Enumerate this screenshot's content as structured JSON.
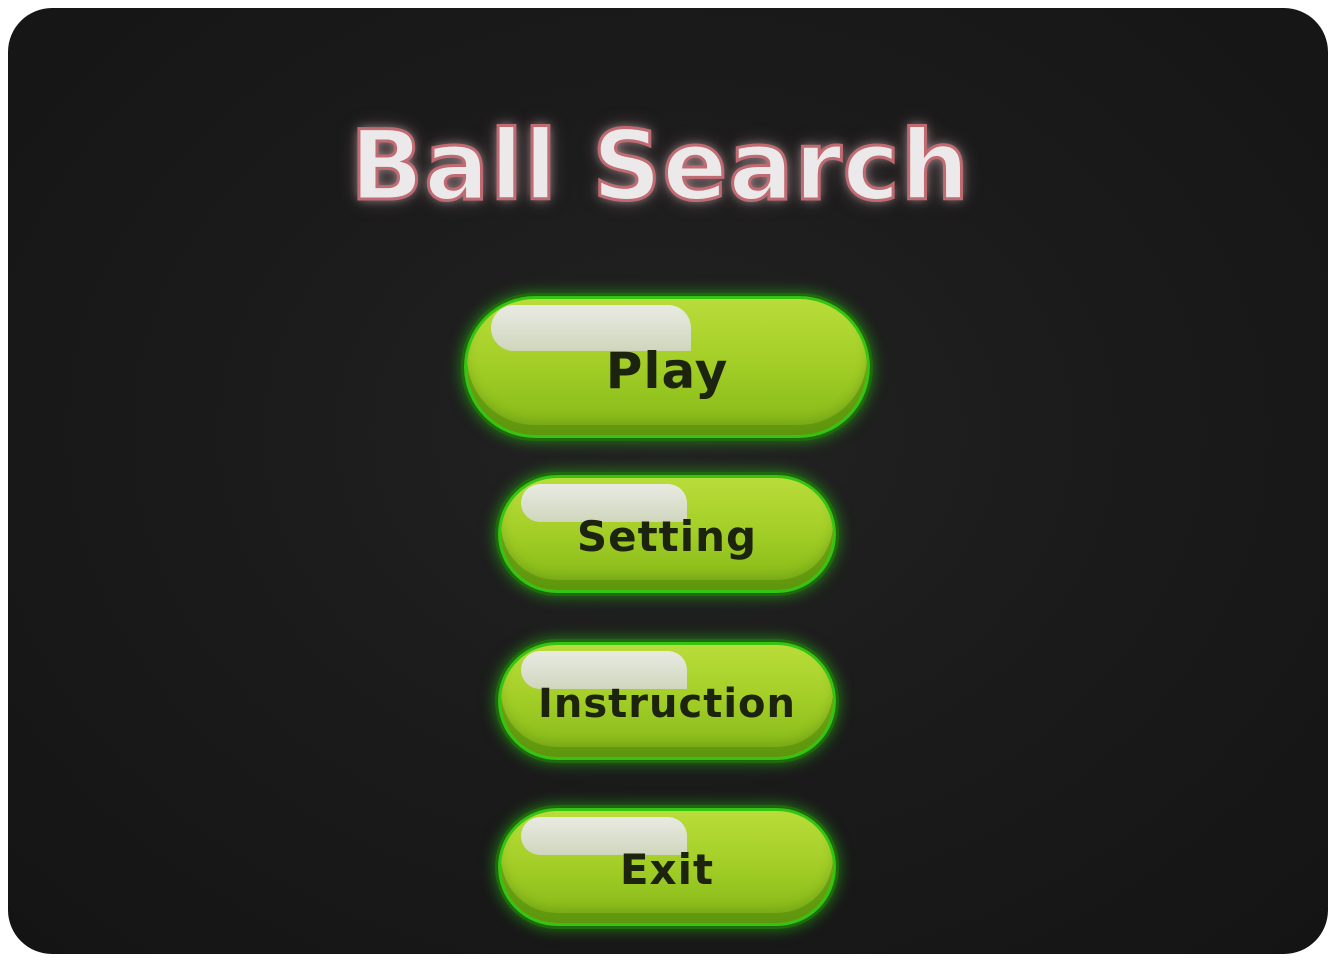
{
  "game": {
    "title": "Ball Search"
  },
  "menu": {
    "items": [
      {
        "id": "play",
        "label": "Play"
      },
      {
        "id": "setting",
        "label": "Setting"
      },
      {
        "id": "instruction",
        "label": "Instruction"
      },
      {
        "id": "exit",
        "label": "Exit"
      }
    ]
  },
  "colors": {
    "background": "#1b1b1b",
    "title_fill": "#ece9ea",
    "title_outline": "#c06a72",
    "button_fill": "#a5cf28",
    "button_border": "#34c411",
    "button_text": "#1c2410"
  }
}
